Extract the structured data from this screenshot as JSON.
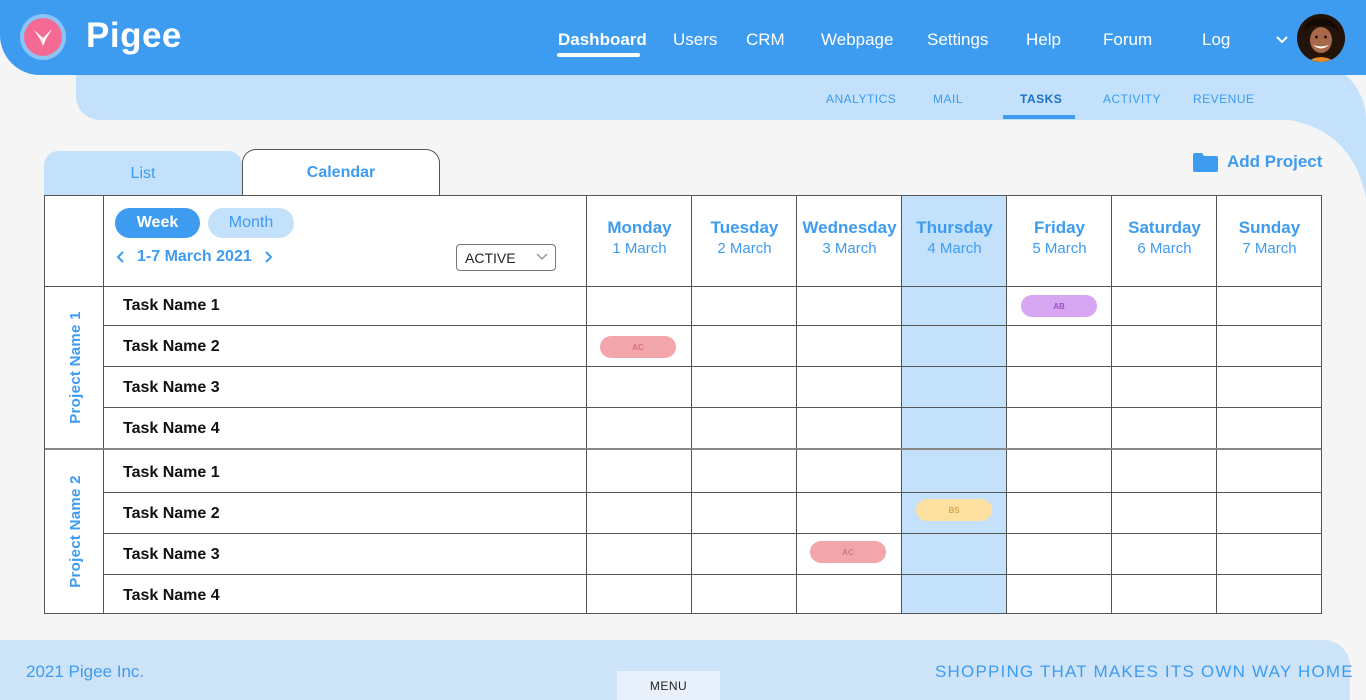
{
  "brand": {
    "name": "Pigee"
  },
  "nav": {
    "items": [
      "Dashboard",
      "Users",
      "CRM",
      "Webpage",
      "Settings",
      "Help",
      "Forum",
      "Log"
    ],
    "active": "Dashboard"
  },
  "subnav": {
    "items": [
      "ANALYTICS",
      "MAIL",
      "TASKS",
      "ACTIVITY",
      "REVENUE"
    ],
    "active": "TASKS"
  },
  "tabs": {
    "list": "List",
    "calendar": "Calendar",
    "active": "Calendar"
  },
  "add_project": "Add Project",
  "view": {
    "week": "Week",
    "month": "Month",
    "selected": "Week"
  },
  "date_range": "1-7 March 2021",
  "status_filter": {
    "value": "ACTIVE"
  },
  "days": [
    {
      "name": "Monday",
      "date": "1 March"
    },
    {
      "name": "Tuesday",
      "date": "2 March"
    },
    {
      "name": "Wednesday",
      "date": "3 March"
    },
    {
      "name": "Thursday",
      "date": "4 March"
    },
    {
      "name": "Friday",
      "date": "5 March"
    },
    {
      "name": "Saturday",
      "date": "6 March"
    },
    {
      "name": "Sunday",
      "date": "7 March"
    }
  ],
  "highlighted_day": "Thursday",
  "projects": [
    {
      "name": "Project Name 1",
      "tasks": [
        {
          "name": "Task Name 1",
          "assignment": {
            "day": "Friday",
            "initials": "AB",
            "color": "#d7a6f2",
            "text_color": "#9b4fc9"
          }
        },
        {
          "name": "Task Name 2",
          "assignment": {
            "day": "Monday",
            "initials": "AC",
            "color": "#f2a5ab",
            "text_color": "#d9737b"
          }
        },
        {
          "name": "Task Name 3"
        },
        {
          "name": "Task Name 4"
        }
      ]
    },
    {
      "name": "Project Name 2",
      "tasks": [
        {
          "name": "Task Name 1"
        },
        {
          "name": "Task Name 2",
          "assignment": {
            "day": "Thursday",
            "initials": "BS",
            "color": "#fde0a0",
            "text_color": "#d4a851"
          }
        },
        {
          "name": "Task Name 3",
          "assignment": {
            "day": "Wednesday",
            "initials": "AC",
            "color": "#f2a5ab",
            "text_color": "#d9737b"
          }
        },
        {
          "name": "Task Name 4"
        }
      ]
    }
  ],
  "footer": {
    "copyright": "2021 Pigee Inc.",
    "menu": "MENU",
    "tagline": "SHOPPING THAT MAKES ITS OWN WAY HOME"
  },
  "colors": {
    "primary": "#3d9bf0",
    "light": "#c3e1fb",
    "footer": "#cde4f8"
  }
}
